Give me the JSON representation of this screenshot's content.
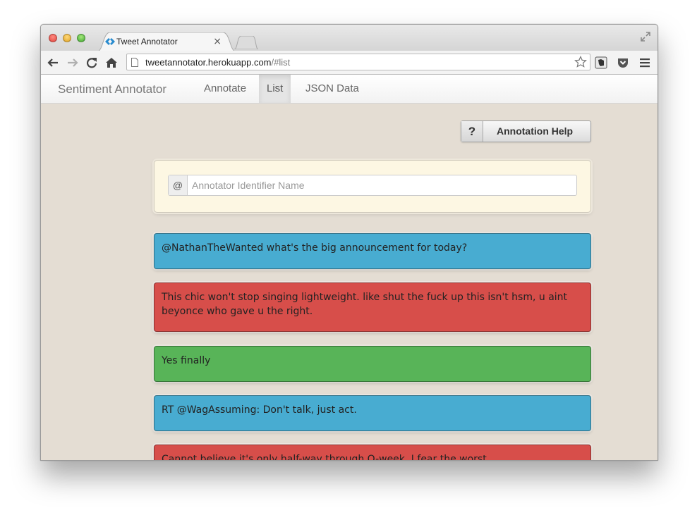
{
  "browser": {
    "tab_title": "Tweet Annotator",
    "tab_close": "×",
    "url_host": "tweetannotator.herokuapp.com",
    "url_path": "/#list"
  },
  "navbar": {
    "brand": "Sentiment Annotator",
    "items": [
      {
        "label": "Annotate",
        "active": false
      },
      {
        "label": "List",
        "active": true
      },
      {
        "label": "JSON Data",
        "active": false
      }
    ]
  },
  "help_button": {
    "icon": "?",
    "label": "Annotation Help"
  },
  "annotator": {
    "prefix": "@",
    "placeholder": "Annotator Identifier Name",
    "value": ""
  },
  "tweets": [
    {
      "text": "@NathanTheWanted what's the big announcement for today?",
      "sentiment": "neutral",
      "color": "#48acd1"
    },
    {
      "text": "This chic won't stop singing lightweight. like shut the fuck up this isn't hsm, u aint beyonce who gave u the right.",
      "sentiment": "negative",
      "color": "#d74e4a"
    },
    {
      "text": "Yes finally",
      "sentiment": "positive",
      "color": "#58b458"
    },
    {
      "text": "RT @WagAssuming: Don't talk, just act.",
      "sentiment": "neutral",
      "color": "#48acd1"
    },
    {
      "text": "Cannot believe it's only half-way through O-week. I fear the worst.",
      "sentiment": "negative",
      "color": "#d74e4a"
    }
  ]
}
